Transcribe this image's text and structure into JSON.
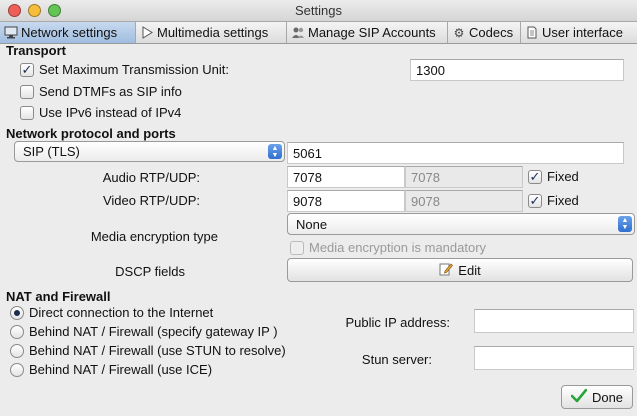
{
  "window": {
    "title": "Settings"
  },
  "tabs": [
    {
      "label": "Network settings",
      "icon": "network-icon",
      "active": true
    },
    {
      "label": "Multimedia settings",
      "icon": "play-icon"
    },
    {
      "label": "Manage SIP Accounts",
      "icon": "people-icon"
    },
    {
      "label": "Codecs",
      "icon": "gear-icon"
    },
    {
      "label": "User interface",
      "icon": "document-icon"
    }
  ],
  "transport": {
    "heading": "Transport",
    "mtu_label": "Set Maximum Transmission Unit:",
    "mtu_checked": true,
    "mtu_value": "1300",
    "dtmf_label": "Send DTMFs as SIP info",
    "dtmf_checked": false,
    "ipv6_label": "Use IPv6 instead of IPv4",
    "ipv6_checked": false
  },
  "protocol": {
    "heading": "Network protocol and ports",
    "protocol_selected": "SIP (TLS)",
    "port_value": "5061",
    "audio_label": "Audio RTP/UDP:",
    "audio_port": "7078",
    "audio_port_max": "7078",
    "audio_fixed_label": "Fixed",
    "audio_fixed_checked": true,
    "video_label": "Video RTP/UDP:",
    "video_port": "9078",
    "video_port_max": "9078",
    "video_fixed_label": "Fixed",
    "video_fixed_checked": true,
    "media_enc_label": "Media encryption type",
    "media_enc_selected": "None",
    "media_enc_mandatory_label": "Media encryption is mandatory",
    "dscp_label": "DSCP fields",
    "edit_button_label": "Edit"
  },
  "nat": {
    "heading": "NAT and Firewall",
    "options": [
      {
        "label": "Direct connection to the Internet",
        "selected": true
      },
      {
        "label": "Behind NAT / Firewall (specify gateway IP )",
        "selected": false
      },
      {
        "label": "Behind NAT / Firewall (use STUN to resolve)",
        "selected": false
      },
      {
        "label": "Behind NAT / Firewall (use ICE)",
        "selected": false
      }
    ],
    "public_ip_label": "Public IP address:",
    "public_ip_value": "",
    "stun_label": "Stun server:",
    "stun_value": ""
  },
  "footer": {
    "done_label": "Done"
  },
  "colors": {
    "traffic_close": "#ee5f58",
    "traffic_min": "#f6bd3b",
    "traffic_max": "#62c554",
    "done_check": "#2aa43a"
  }
}
